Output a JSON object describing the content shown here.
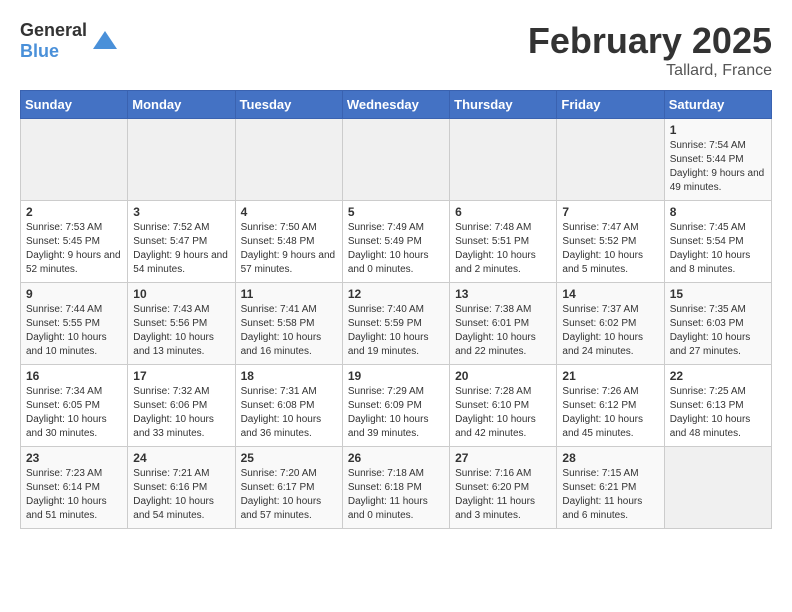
{
  "header": {
    "logo_general": "General",
    "logo_blue": "Blue",
    "title": "February 2025",
    "subtitle": "Tallard, France"
  },
  "days_of_week": [
    "Sunday",
    "Monday",
    "Tuesday",
    "Wednesday",
    "Thursday",
    "Friday",
    "Saturday"
  ],
  "weeks": [
    [
      {
        "day": "",
        "info": ""
      },
      {
        "day": "",
        "info": ""
      },
      {
        "day": "",
        "info": ""
      },
      {
        "day": "",
        "info": ""
      },
      {
        "day": "",
        "info": ""
      },
      {
        "day": "",
        "info": ""
      },
      {
        "day": "1",
        "info": "Sunrise: 7:54 AM\nSunset: 5:44 PM\nDaylight: 9 hours and 49 minutes."
      }
    ],
    [
      {
        "day": "2",
        "info": "Sunrise: 7:53 AM\nSunset: 5:45 PM\nDaylight: 9 hours and 52 minutes."
      },
      {
        "day": "3",
        "info": "Sunrise: 7:52 AM\nSunset: 5:47 PM\nDaylight: 9 hours and 54 minutes."
      },
      {
        "day": "4",
        "info": "Sunrise: 7:50 AM\nSunset: 5:48 PM\nDaylight: 9 hours and 57 minutes."
      },
      {
        "day": "5",
        "info": "Sunrise: 7:49 AM\nSunset: 5:49 PM\nDaylight: 10 hours and 0 minutes."
      },
      {
        "day": "6",
        "info": "Sunrise: 7:48 AM\nSunset: 5:51 PM\nDaylight: 10 hours and 2 minutes."
      },
      {
        "day": "7",
        "info": "Sunrise: 7:47 AM\nSunset: 5:52 PM\nDaylight: 10 hours and 5 minutes."
      },
      {
        "day": "8",
        "info": "Sunrise: 7:45 AM\nSunset: 5:54 PM\nDaylight: 10 hours and 8 minutes."
      }
    ],
    [
      {
        "day": "9",
        "info": "Sunrise: 7:44 AM\nSunset: 5:55 PM\nDaylight: 10 hours and 10 minutes."
      },
      {
        "day": "10",
        "info": "Sunrise: 7:43 AM\nSunset: 5:56 PM\nDaylight: 10 hours and 13 minutes."
      },
      {
        "day": "11",
        "info": "Sunrise: 7:41 AM\nSunset: 5:58 PM\nDaylight: 10 hours and 16 minutes."
      },
      {
        "day": "12",
        "info": "Sunrise: 7:40 AM\nSunset: 5:59 PM\nDaylight: 10 hours and 19 minutes."
      },
      {
        "day": "13",
        "info": "Sunrise: 7:38 AM\nSunset: 6:01 PM\nDaylight: 10 hours and 22 minutes."
      },
      {
        "day": "14",
        "info": "Sunrise: 7:37 AM\nSunset: 6:02 PM\nDaylight: 10 hours and 24 minutes."
      },
      {
        "day": "15",
        "info": "Sunrise: 7:35 AM\nSunset: 6:03 PM\nDaylight: 10 hours and 27 minutes."
      }
    ],
    [
      {
        "day": "16",
        "info": "Sunrise: 7:34 AM\nSunset: 6:05 PM\nDaylight: 10 hours and 30 minutes."
      },
      {
        "day": "17",
        "info": "Sunrise: 7:32 AM\nSunset: 6:06 PM\nDaylight: 10 hours and 33 minutes."
      },
      {
        "day": "18",
        "info": "Sunrise: 7:31 AM\nSunset: 6:08 PM\nDaylight: 10 hours and 36 minutes."
      },
      {
        "day": "19",
        "info": "Sunrise: 7:29 AM\nSunset: 6:09 PM\nDaylight: 10 hours and 39 minutes."
      },
      {
        "day": "20",
        "info": "Sunrise: 7:28 AM\nSunset: 6:10 PM\nDaylight: 10 hours and 42 minutes."
      },
      {
        "day": "21",
        "info": "Sunrise: 7:26 AM\nSunset: 6:12 PM\nDaylight: 10 hours and 45 minutes."
      },
      {
        "day": "22",
        "info": "Sunrise: 7:25 AM\nSunset: 6:13 PM\nDaylight: 10 hours and 48 minutes."
      }
    ],
    [
      {
        "day": "23",
        "info": "Sunrise: 7:23 AM\nSunset: 6:14 PM\nDaylight: 10 hours and 51 minutes."
      },
      {
        "day": "24",
        "info": "Sunrise: 7:21 AM\nSunset: 6:16 PM\nDaylight: 10 hours and 54 minutes."
      },
      {
        "day": "25",
        "info": "Sunrise: 7:20 AM\nSunset: 6:17 PM\nDaylight: 10 hours and 57 minutes."
      },
      {
        "day": "26",
        "info": "Sunrise: 7:18 AM\nSunset: 6:18 PM\nDaylight: 11 hours and 0 minutes."
      },
      {
        "day": "27",
        "info": "Sunrise: 7:16 AM\nSunset: 6:20 PM\nDaylight: 11 hours and 3 minutes."
      },
      {
        "day": "28",
        "info": "Sunrise: 7:15 AM\nSunset: 6:21 PM\nDaylight: 11 hours and 6 minutes."
      },
      {
        "day": "",
        "info": ""
      }
    ]
  ]
}
